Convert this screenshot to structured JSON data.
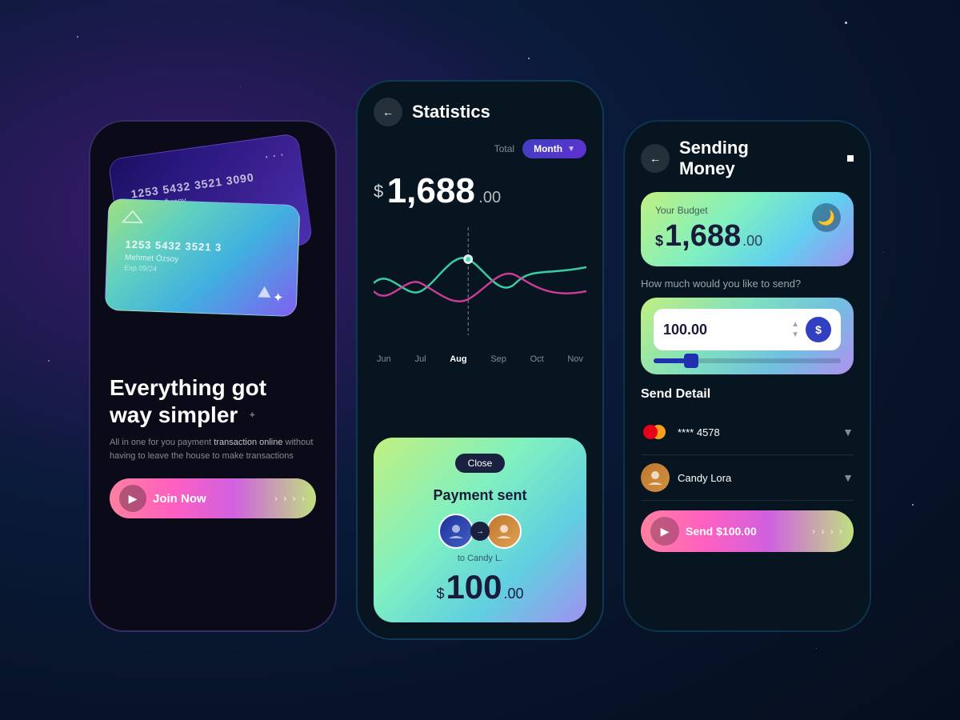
{
  "background": {
    "color": "#050e1e"
  },
  "phone1": {
    "card_back": {
      "number": "1253 5432 3521 3090",
      "name": "Mehmet Özsoy",
      "dots": "···"
    },
    "card_front": {
      "number": "1253 5432 3521 3",
      "name": "Mehmet Özsoy",
      "exp_label": "Exp",
      "exp": "09/24"
    },
    "headline_line1": "Everything got",
    "headline_line2": "way simpler",
    "subtext": "All in one for you payment transaction online without having to leave the house to make transactions",
    "subtext_highlight": "transaction online",
    "join_label": "Join Now",
    "arrows": "› › › ›"
  },
  "phone2": {
    "back_icon": "←",
    "title": "Statistics",
    "filter_label": "Total",
    "filter_value": "Month",
    "amount": "1,688",
    "amount_cents": ".00",
    "chart": {
      "labels": [
        "Jun",
        "Jul",
        "Aug",
        "Sep",
        "Oct",
        "Nov"
      ],
      "active_label": "Aug"
    },
    "popup": {
      "close_label": "Close",
      "title": "Payment sent",
      "to_text": "to Candy L.",
      "amount": "100",
      "amount_cents": ".00"
    }
  },
  "phone3": {
    "back_icon": "←",
    "title_line1": "Sending",
    "title_line2": "Money",
    "budget_label": "Your Budget",
    "budget_amount": "1,688",
    "budget_cents": ".00",
    "send_label": "How much would you like to send?",
    "send_value": "100.00",
    "send_detail_label": "Send Detail",
    "card_detail": "**** 4578",
    "recipient_name": "Candy Lora",
    "send_btn_label": "Send $100.00",
    "arrows": "› › › ›"
  }
}
